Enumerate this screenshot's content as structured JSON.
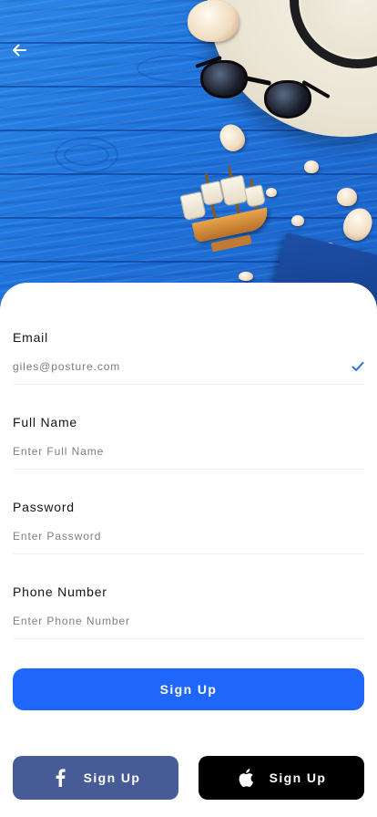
{
  "hero": {
    "image_description_icon": "beach-hero-image",
    "back_icon": "arrow-left-icon"
  },
  "form": {
    "email": {
      "label": "Email",
      "value": "giles@posture.com",
      "valid_icon": "check-icon"
    },
    "full_name": {
      "label": "Full Name",
      "placeholder": "Enter Full Name"
    },
    "password": {
      "label": "Password",
      "placeholder": "Enter Password"
    },
    "phone": {
      "label": "Phone Number",
      "placeholder": "Enter Phone Number"
    }
  },
  "actions": {
    "sign_up_label": "Sign Up",
    "facebook_label": "Sign Up",
    "facebook_icon": "facebook-icon",
    "apple_label": "Sign Up",
    "apple_icon": "apple-icon"
  },
  "colors": {
    "primary": "#1f66fb",
    "facebook": "#475b96",
    "apple": "#000000",
    "check": "#2f6fe6",
    "hero_blue": "#1f74dc"
  }
}
